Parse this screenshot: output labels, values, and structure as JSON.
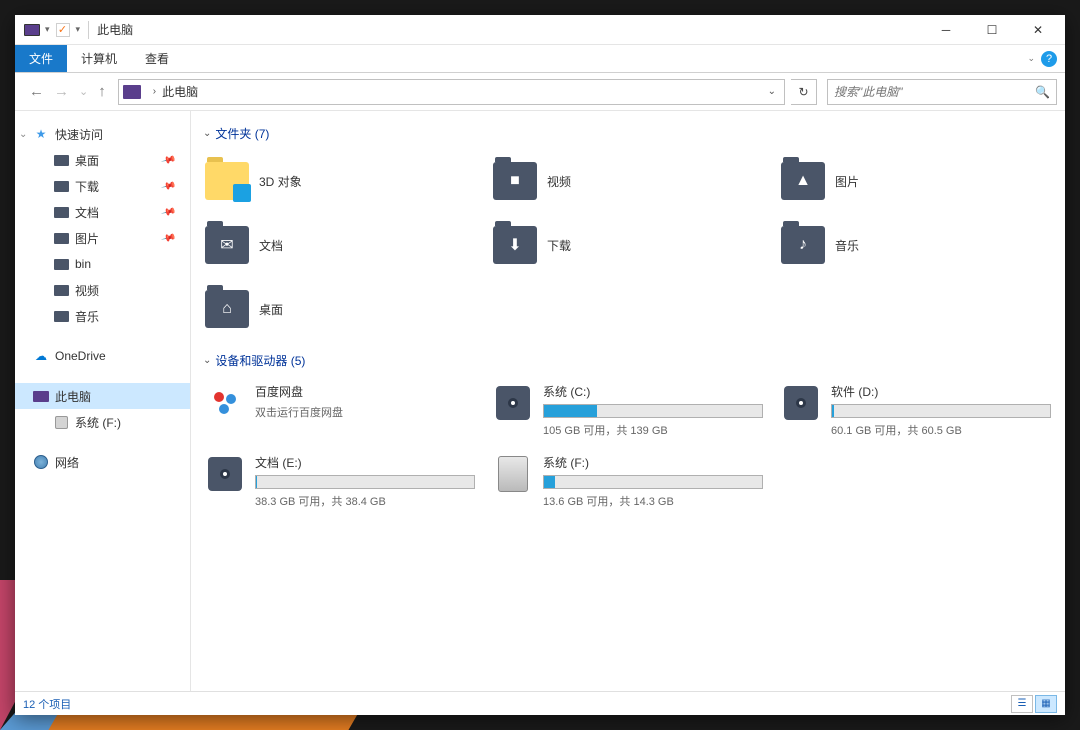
{
  "title": "此电脑",
  "ribbon": {
    "file": "文件",
    "computer": "计算机",
    "view": "查看"
  },
  "address": {
    "location": "此电脑"
  },
  "search": {
    "placeholder": "搜索\"此电脑\""
  },
  "sidebar": {
    "quick_access": "快速访问",
    "items": [
      {
        "label": "桌面",
        "pinned": true
      },
      {
        "label": "下载",
        "pinned": true
      },
      {
        "label": "文档",
        "pinned": true
      },
      {
        "label": "图片",
        "pinned": true
      },
      {
        "label": "bin",
        "pinned": false
      },
      {
        "label": "视频",
        "pinned": false
      },
      {
        "label": "音乐",
        "pinned": false
      }
    ],
    "onedrive": "OneDrive",
    "this_pc": "此电脑",
    "drive_f": "系统 (F:)",
    "network": "网络"
  },
  "sections": {
    "folders": {
      "title": "文件夹 (7)",
      "items": [
        "3D 对象",
        "视频",
        "图片",
        "文档",
        "下载",
        "音乐",
        "桌面"
      ]
    },
    "devices": {
      "title": "设备和驱动器 (5)",
      "items": [
        {
          "name": "百度网盘",
          "sub": "双击运行百度网盘",
          "type": "app"
        },
        {
          "name": "系统 (C:)",
          "free": "105 GB 可用，共 139 GB",
          "pct": 24.5,
          "type": "disk"
        },
        {
          "name": "软件 (D:)",
          "free": "60.1 GB 可用，共 60.5 GB",
          "pct": 0.7,
          "type": "disk"
        },
        {
          "name": "文档 (E:)",
          "free": "38.3 GB 可用，共 38.4 GB",
          "pct": 0.3,
          "type": "disk"
        },
        {
          "name": "系统 (F:)",
          "free": "13.6 GB 可用，共 14.3 GB",
          "pct": 4.9,
          "type": "removable"
        }
      ]
    }
  },
  "status": {
    "items": "12 个项目"
  }
}
